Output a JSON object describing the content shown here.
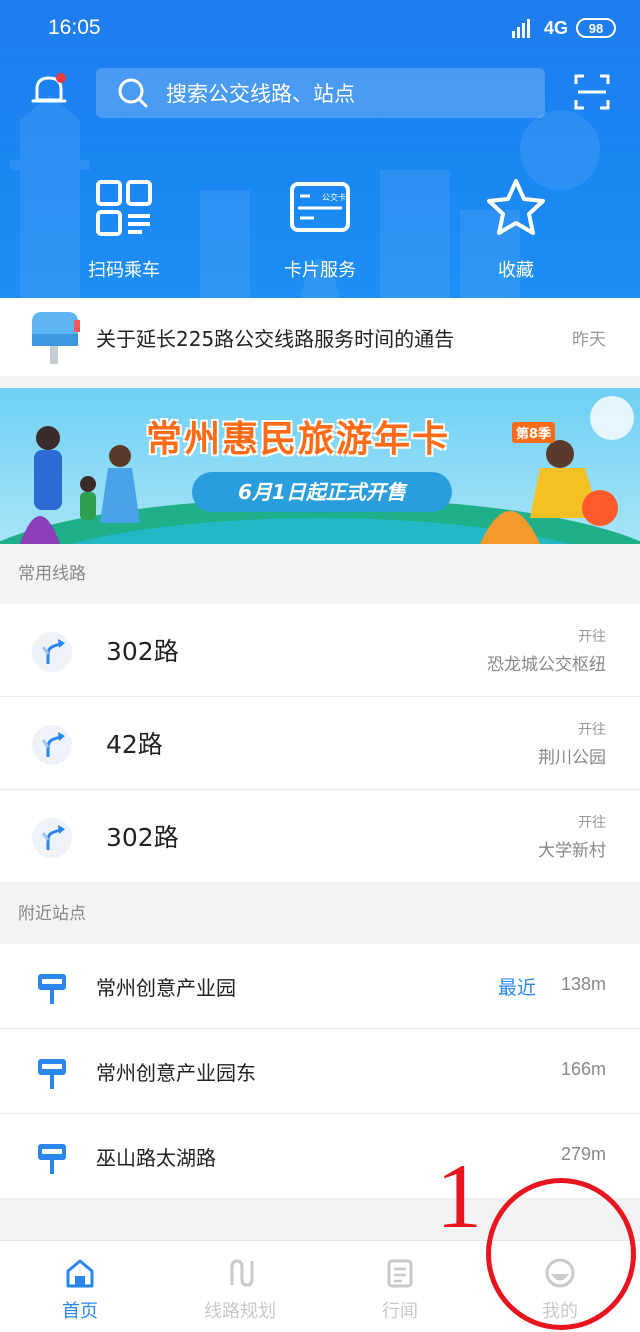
{
  "status_bar": {
    "time": "16:05",
    "network": "4G",
    "battery": "98"
  },
  "header": {
    "search_placeholder": "搜索公交线路、站点",
    "quick_actions": [
      {
        "label": "扫码乘车",
        "icon": "qr-scan-icon"
      },
      {
        "label": "卡片服务",
        "icon": "bus-card-icon",
        "card_text": "公交卡"
      },
      {
        "label": "收藏",
        "icon": "star-icon"
      }
    ]
  },
  "notice": {
    "text": "关于延长225路公交线路服务时间的通告",
    "time": "昨天"
  },
  "banner": {
    "title": "常州惠民旅游年卡",
    "season": "第8季",
    "subtitle": "6月1日起正式开售"
  },
  "routes_section": {
    "label": "常用线路",
    "items": [
      {
        "name": "302路",
        "direction_label": "开往",
        "destination": "恐龙城公交枢纽"
      },
      {
        "name": "42路",
        "direction_label": "开往",
        "destination": "荆川公园"
      },
      {
        "name": "302路",
        "direction_label": "开往",
        "destination": "大学新村"
      }
    ]
  },
  "stops_section": {
    "label": "附近站点",
    "items": [
      {
        "name": "常州创意产业园",
        "tag": "最近",
        "distance": "138m"
      },
      {
        "name": "常州创意产业园东",
        "tag": "",
        "distance": "166m"
      },
      {
        "name": "巫山路太湖路",
        "tag": "",
        "distance": "279m"
      }
    ]
  },
  "tabbar": {
    "tabs": [
      {
        "label": "首页",
        "active": true
      },
      {
        "label": "线路规划",
        "active": false
      },
      {
        "label": "行闻",
        "active": false
      },
      {
        "label": "我的",
        "active": false
      }
    ]
  },
  "annotation": {
    "number": "1"
  },
  "colors": {
    "primary": "#1f7df0",
    "accent": "#2b86ee",
    "annotation": "#e8141e"
  }
}
